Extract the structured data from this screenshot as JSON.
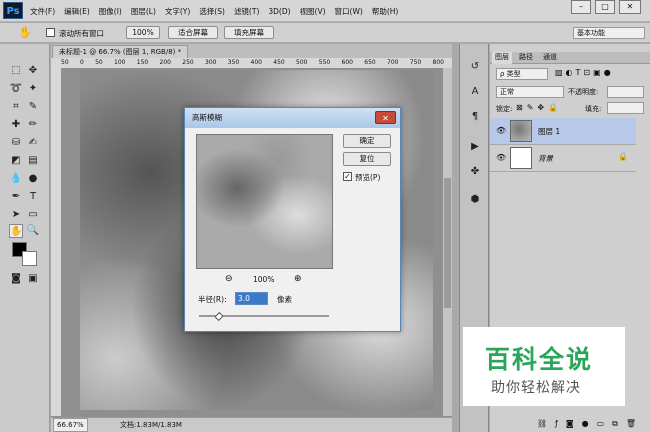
{
  "app": {
    "logo": "Ps",
    "menu": [
      "文件(F)",
      "编辑(E)",
      "图像(I)",
      "图层(L)",
      "文字(Y)",
      "选择(S)",
      "滤镜(T)",
      "3D(D)",
      "视图(V)",
      "窗口(W)",
      "帮助(H)"
    ],
    "win_controls": [
      "–",
      "□",
      "✕"
    ]
  },
  "options": {
    "scroll_all": "滚动所有窗口",
    "zoom": "100%",
    "fit": "适合屏幕",
    "fill": "填充屏幕",
    "workspace": "基本功能"
  },
  "doc": {
    "tab": "未标题-1 @ 66.7% (图层 1, RGB/8) *",
    "ruler": [
      "50",
      "0",
      "50",
      "100",
      "150",
      "200",
      "250",
      "300",
      "350",
      "400",
      "450",
      "500",
      "550",
      "600",
      "650",
      "700",
      "750",
      "800"
    ],
    "zoom_status": "66.67%",
    "doc_status": "文档:1.83M/1.83M"
  },
  "panel": {
    "tabs": [
      "图层",
      "路径",
      "通道"
    ],
    "kind": "ρ 类型",
    "blend": "正常",
    "opacity_label": "不透明度:",
    "lock_label": "锁定:",
    "fill_label": "填充:",
    "layers": [
      "图层 1",
      "背景"
    ]
  },
  "dialog": {
    "title": "高斯模糊",
    "ok": "确定",
    "reset": "复位",
    "preview_label": "预览(P)",
    "zoom": "100%",
    "radius_label": "半径(R):",
    "radius_value": "3.0",
    "unit": "像素",
    "zoom_out": "⊖",
    "zoom_in": "⊕"
  },
  "watermark": {
    "title": "百科全说",
    "subtitle": "助你轻松解决"
  }
}
